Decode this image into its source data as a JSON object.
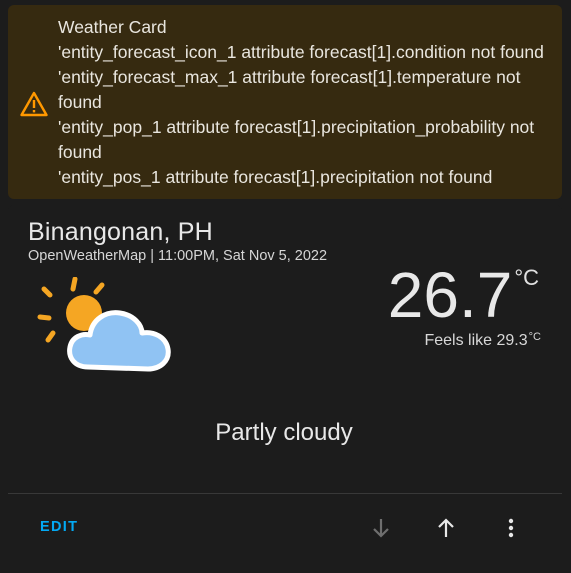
{
  "warning": {
    "title": "Weather Card",
    "lines": [
      "'entity_forecast_icon_1 attribute forecast[1].condition not found",
      "'entity_forecast_max_1 attribute forecast[1].temperature not found",
      "'entity_pop_1 attribute forecast[1].precipitation_probability not found",
      "'entity_pos_1 attribute forecast[1].precipitation not found"
    ],
    "icon": "warning-triangle-icon",
    "color": "#ff9800"
  },
  "weather": {
    "location": "Binangonan, PH",
    "subtitle": "OpenWeatherMap | 11:00PM, Sat Nov 5, 2022",
    "icon": "partly-cloudy-icon",
    "temperature": "26.7",
    "temp_unit": "°C",
    "feels_like_label": "Feels like 29.3",
    "feels_like_unit": "°C",
    "condition": "Partly cloudy"
  },
  "actions": {
    "edit_label": "EDIT",
    "move_down_icon": "arrow-down-icon",
    "move_up_icon": "arrow-up-icon",
    "menu_icon": "more-vertical-icon",
    "accent_color": "#03a9f4"
  }
}
